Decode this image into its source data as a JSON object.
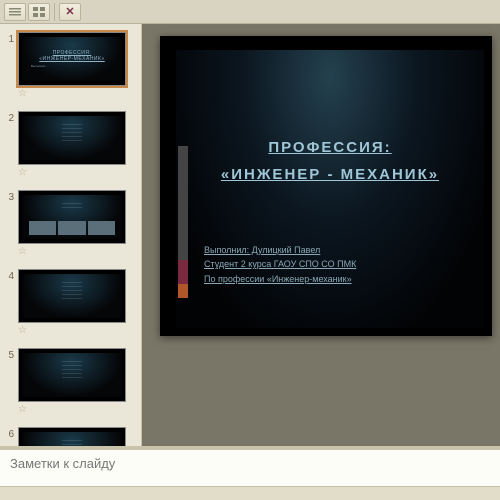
{
  "toolbar": {
    "tool1_name": "outline-view",
    "tool2_name": "slide-sorter-view"
  },
  "thumbnails": [
    {
      "num": "1",
      "selected": true,
      "kind": "title"
    },
    {
      "num": "2",
      "selected": false,
      "kind": "text"
    },
    {
      "num": "3",
      "selected": false,
      "kind": "images"
    },
    {
      "num": "4",
      "selected": false,
      "kind": "text"
    },
    {
      "num": "5",
      "selected": false,
      "kind": "text"
    },
    {
      "num": "6",
      "selected": false,
      "kind": "text"
    }
  ],
  "slide": {
    "title_line1": "ПРОФЕССИЯ:",
    "title_line2": "«ИНЖЕНЕР  -  МЕХАНИК»",
    "author_line1": "Выполнил: Дулицкий Павел",
    "author_line2": "Студент 2 курса ГАОУ СПО СО ПМК",
    "author_line3": "По профессии «Инженер-механик»"
  },
  "notes": {
    "placeholder": "Заметки к слайду"
  }
}
